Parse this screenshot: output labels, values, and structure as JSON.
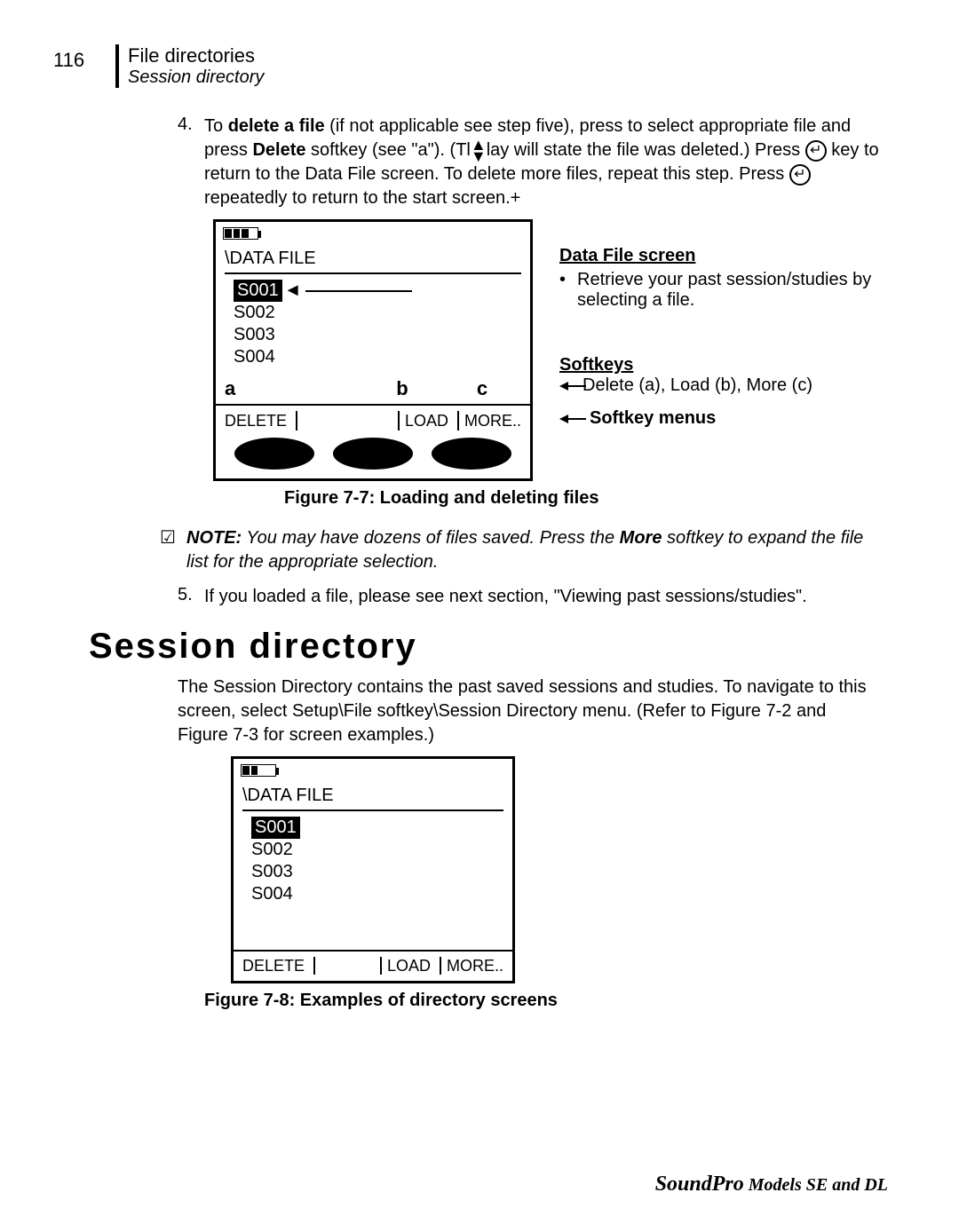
{
  "page_number": "116",
  "header": {
    "title": "File directories",
    "subtitle": "Session directory"
  },
  "step4": {
    "num": "4.",
    "pre": "To ",
    "bold1": "delete a file",
    "mid1": " (if not applicable see step five), press ",
    "mid2": " to select appropriate file and press ",
    "bold2": "Delete",
    "mid3": " softkey (see \"a\").  (Tl",
    "mid4": "lay will state the file was deleted.)  Press ",
    "mid5": " key to return to the Data File screen. To delete more files, repeat this step.  Press",
    "mid6": " repeatedly to return to the start screen.+"
  },
  "fig77": {
    "screen_title": "\\DATA FILE",
    "files": {
      "f1": "S001",
      "f2": "S002",
      "f3": "S003",
      "f4": "S004"
    },
    "labels": {
      "a": "a",
      "b": "b",
      "c": "c"
    },
    "softkeys": {
      "delete": "DELETE",
      "load": "LOAD",
      "more": "MORE.."
    },
    "caption": "Figure 7-7:  Loading and deleting files",
    "notes": {
      "h1": "Data File screen",
      "b1": "Retrieve your past session/studies by selecting a file.",
      "h2": "Softkeys",
      "b2": "Delete (a), Load (b), More (c)",
      "h3": "Softkey menus"
    }
  },
  "note": {
    "label": "NOTE:",
    "text": "  You may have dozens of files saved.  Press the ",
    "more": "More",
    "text2": " softkey to expand the file list for the appropriate selection."
  },
  "step5": {
    "num": "5.",
    "text": "If you loaded a file, please see next section, \"Viewing past sessions/studies\"."
  },
  "section": {
    "title": "Session directory",
    "para": "The Session Directory contains the past saved sessions and studies.  To navigate to this screen, select Setup\\File softkey\\Session Directory menu.  (Refer to Figure 7-2 and Figure 7-3 for screen examples.)"
  },
  "fig78": {
    "screen_title": "\\DATA FILE",
    "files": {
      "f1": "S001",
      "f2": "S002",
      "f3": "S003",
      "f4": "S004"
    },
    "softkeys": {
      "delete": "DELETE",
      "load": "LOAD",
      "more": "MORE.."
    },
    "caption": "Figure 7-8:  Examples of directory screens"
  },
  "footer": {
    "brand": "SoundPro",
    "models": "  Models SE and DL"
  }
}
